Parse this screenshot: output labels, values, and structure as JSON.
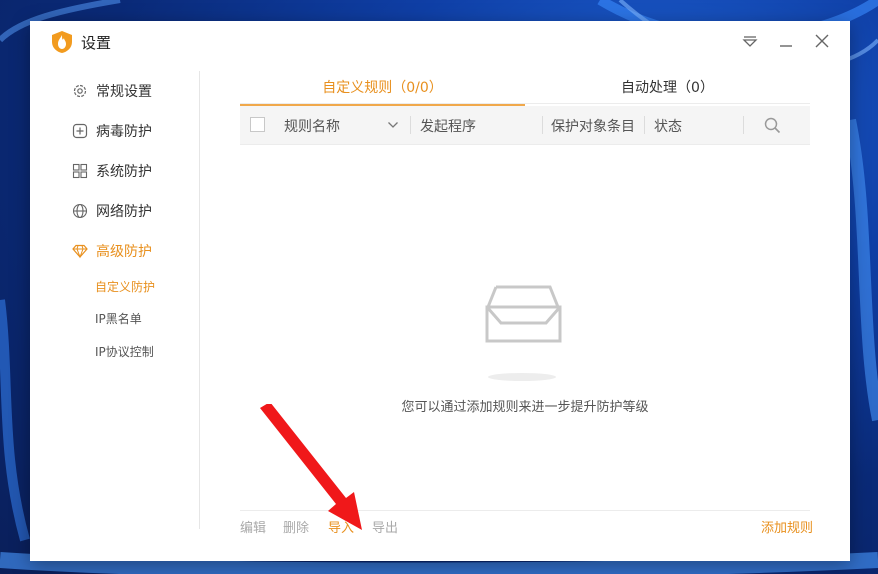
{
  "window": {
    "title": "设置",
    "accent_color": "#e8901e"
  },
  "sidebar": {
    "items": [
      {
        "label": "常规设置",
        "icon": "gear-icon"
      },
      {
        "label": "病毒防护",
        "icon": "plus-box-icon"
      },
      {
        "label": "系统防护",
        "icon": "windows-icon"
      },
      {
        "label": "网络防护",
        "icon": "globe-icon"
      },
      {
        "label": "高级防护",
        "icon": "diamond-icon",
        "active": true
      }
    ],
    "sub_items": [
      {
        "label": "自定义防护",
        "active": true
      },
      {
        "label": "IP黑名单"
      },
      {
        "label": "IP协议控制"
      }
    ]
  },
  "tabs": [
    {
      "label": "自定义规则（0/0）",
      "active": true
    },
    {
      "label": "自动处理（0）"
    }
  ],
  "table": {
    "columns": [
      "规则名称",
      "发起程序",
      "保护对象条目",
      "状态"
    ]
  },
  "empty_state": {
    "text": "您可以通过添加规则来进一步提升防护等级"
  },
  "footer": {
    "edit": "编辑",
    "delete": "删除",
    "import": "导入",
    "export": "导出",
    "add_rule": "添加规则"
  }
}
